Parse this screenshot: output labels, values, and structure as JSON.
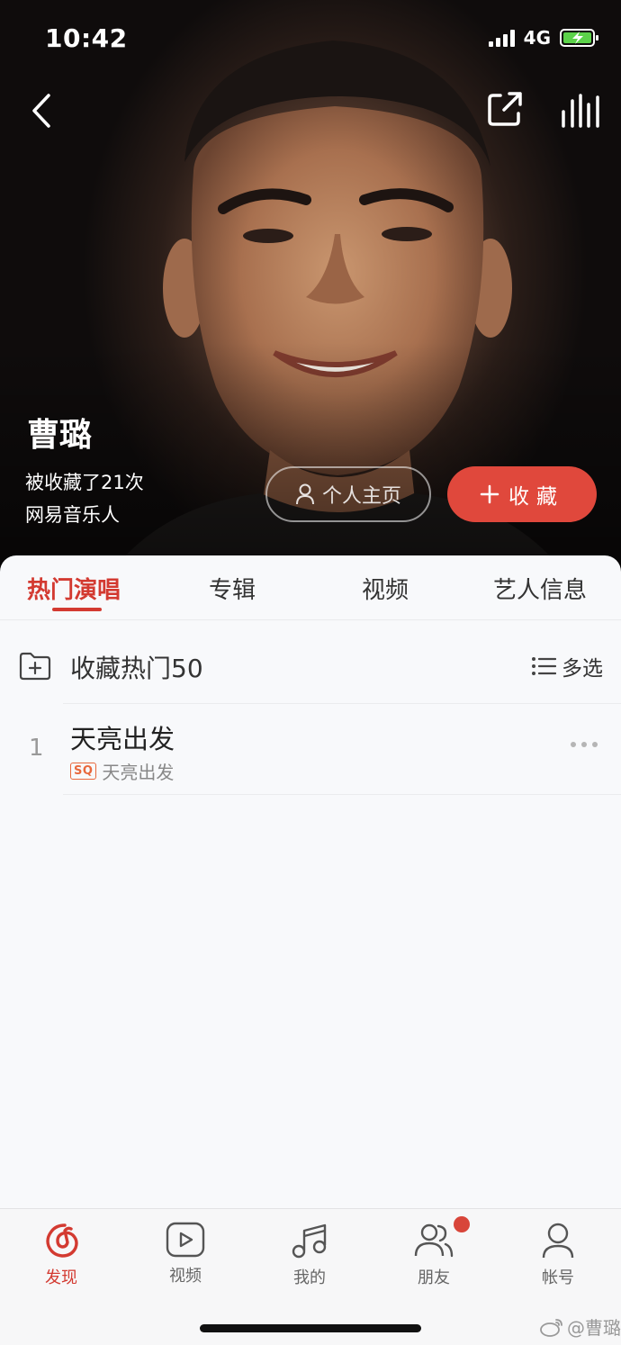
{
  "status_bar": {
    "time": "10:42",
    "network": "4G"
  },
  "artist": {
    "name": "曹璐",
    "favorited_text": "被收藏了21次",
    "role": "网易音乐人",
    "profile_button": "个人主页",
    "collect_button": "收藏"
  },
  "tabs": [
    {
      "label": "热门演唱",
      "active": true
    },
    {
      "label": "专辑"
    },
    {
      "label": "视频"
    },
    {
      "label": "艺人信息"
    }
  ],
  "song_list": {
    "collect_all_label": "收藏热门50",
    "multi_select_label": "多选",
    "songs": [
      {
        "index": "1",
        "title": "天亮出发",
        "quality": "SQ",
        "album": "天亮出发"
      }
    ]
  },
  "bottom_nav": [
    {
      "label": "发现",
      "icon": "netease-music-icon",
      "active": true
    },
    {
      "label": "视频",
      "icon": "video-icon"
    },
    {
      "label": "我的",
      "icon": "music-note-icon"
    },
    {
      "label": "朋友",
      "icon": "friends-icon",
      "badge": true
    },
    {
      "label": "帐号",
      "icon": "account-icon"
    }
  ],
  "watermark": "@曹璐",
  "colors": {
    "accent": "#d33a31",
    "collect_button": "#e0483c",
    "quality_badge": "#e8683c"
  }
}
